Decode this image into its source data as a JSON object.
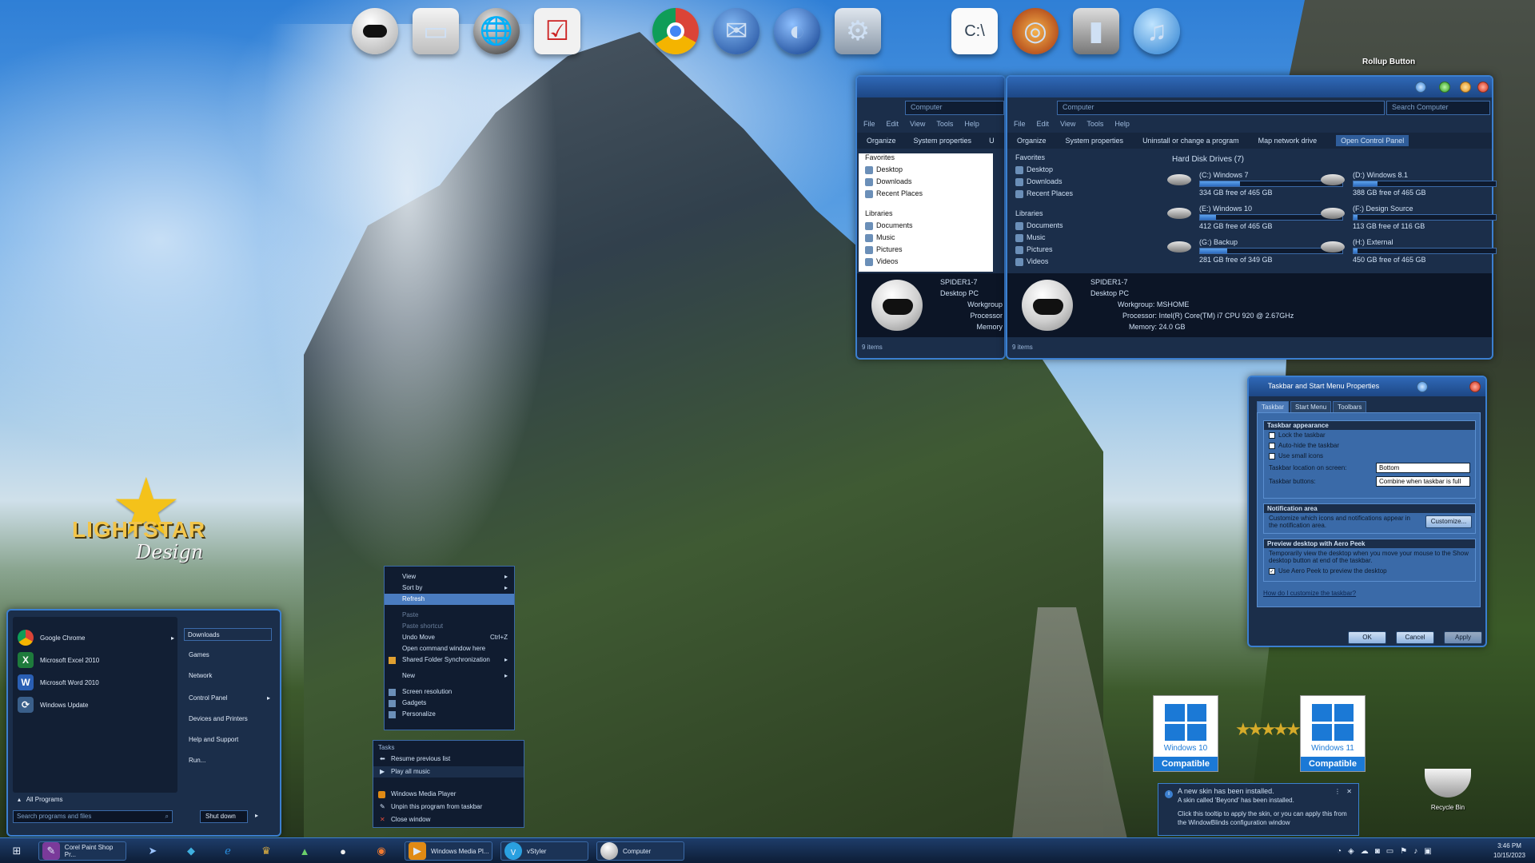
{
  "dock": {
    "icons": [
      "astronaut-helmet-icon",
      "hard-drive-icon",
      "globe-icon",
      "checklist-icon",
      "chrome-icon",
      "thunderbird-icon",
      "google-earth-icon",
      "control-panel-icon",
      "command-prompt-icon",
      "media-player-icon",
      "computer-tower-icon",
      "music-notes-icon"
    ],
    "cmd_label": "C:\\"
  },
  "rollup_label": "Rollup Button",
  "logo": {
    "line1": "LIGHTSTAR",
    "line2": "Design"
  },
  "explorer_back": {
    "address": "Computer",
    "menu": [
      "File",
      "Edit",
      "View",
      "Tools",
      "Help"
    ],
    "toolbar": [
      "Organize",
      "System properties",
      "U"
    ],
    "nav": [
      "Favorites",
      "Desktop",
      "Downloads",
      "Recent Places",
      "Libraries",
      "Documents",
      "Music",
      "Pictures",
      "Videos"
    ],
    "pc_name": "SPIDER1-7",
    "pc_type": "Desktop PC",
    "labels": [
      "Workgroup",
      "Processor",
      "Memory"
    ],
    "status": "9 items"
  },
  "explorer_front": {
    "address": "Computer",
    "search": "Search Computer",
    "menu": [
      "File",
      "Edit",
      "View",
      "Tools",
      "Help"
    ],
    "toolbar": [
      "Organize",
      "System properties",
      "Uninstall or change a program",
      "Map network drive",
      "Open Control Panel"
    ],
    "nav": [
      "Favorites",
      "Desktop",
      "Downloads",
      "Recent Places",
      "Libraries",
      "Documents",
      "Music",
      "Pictures",
      "Videos"
    ],
    "group_header": "Hard Disk Drives (7)",
    "drives": [
      {
        "name": "(C:) Windows 7",
        "free": "334 GB free of 465 GB",
        "used": 0.28
      },
      {
        "name": "(D:) Windows 8.1",
        "free": "388 GB free of 465 GB",
        "used": 0.17
      },
      {
        "name": "(E:) Windows 10",
        "free": "412 GB free of 465 GB",
        "used": 0.11
      },
      {
        "name": "(F:) Design Source",
        "free": "113 GB free of 116 GB",
        "used": 0.03
      },
      {
        "name": "(G:) Backup",
        "free": "281 GB free of 349 GB",
        "used": 0.19
      },
      {
        "name": "(H:) External",
        "free": "450 GB free of 465 GB",
        "used": 0.03
      }
    ],
    "pc_name": "SPIDER1-7",
    "pc_type": "Desktop PC",
    "workgroup": "Workgroup:  MSHOME",
    "processor": "Processor:  Intel(R) Core(TM) i7 CPU        920  @ 2.67GHz",
    "memory": "Memory:  24.0 GB",
    "status": "9 items"
  },
  "dialog": {
    "title": "Taskbar and Start Menu Properties",
    "tabs": [
      "Taskbar",
      "Start Menu",
      "Toolbars"
    ],
    "g1": "Taskbar appearance",
    "lock": "Lock the taskbar",
    "autohide": "Auto-hide the taskbar",
    "small": "Use small icons",
    "location_label": "Taskbar location on screen:",
    "location_value": "Bottom",
    "buttons_label": "Taskbar buttons:",
    "buttons_value": "Combine when taskbar is full",
    "g2": "Notification area",
    "g2_text": "Customize which icons and notifications appear in the notification area.",
    "customize": "Customize...",
    "g3": "Preview desktop with Aero Peek",
    "g3_text": "Temporarily view the desktop when you move your mouse to the Show desktop button at end of the taskbar.",
    "aero": "Use Aero Peek to preview the desktop",
    "link": "How do I customize the taskbar?",
    "ok": "OK",
    "cancel": "Cancel",
    "apply": "Apply"
  },
  "start_menu": {
    "programs": [
      "Google Chrome",
      "Microsoft Excel 2010",
      "Microsoft Word 2010",
      "Windows Update"
    ],
    "right": [
      "Downloads",
      "Games",
      "Network",
      "Control Panel",
      "Devices and Printers",
      "Help and Support",
      "Run..."
    ],
    "all_programs": "All Programs",
    "search": "Search programs and files",
    "shutdown": "Shut down"
  },
  "context_menu": {
    "view": "View",
    "sortby": "Sort by",
    "refresh": "Refresh",
    "paste": "Paste",
    "paste_shortcut": "Paste shortcut",
    "undo": "Undo Move",
    "undo_key": "Ctrl+Z",
    "open_cmd": "Open command window here",
    "shared": "Shared Folder Synchronization",
    "new": "New",
    "screen_res": "Screen resolution",
    "gadgets": "Gadgets",
    "personalize": "Personalize"
  },
  "jumplist": {
    "tasks": "Tasks",
    "resume": "Resume previous list",
    "play": "Play all music",
    "wmp": "Windows Media Player",
    "unpin": "Unpin this program from taskbar",
    "close": "Close window"
  },
  "badges": {
    "w10_name": "Windows 10",
    "w11_name": "Windows 11",
    "compatible": "Compatible"
  },
  "toast": {
    "title": "A new skin has been installed.",
    "line1": "A skin called 'Beyond' has been installed.",
    "line2": "Click this tooltip to apply the skin, or you can apply this from the WindowBlinds configuration window"
  },
  "recycle_label": "Recycle Bin",
  "taskbar": {
    "paintshop": "Corel Paint Shop Pr...",
    "wmp": "Windows Media Pl...",
    "vstyler": "vStyler",
    "computer": "Computer",
    "time": "3:46 PM",
    "date": "10/15/2023"
  }
}
